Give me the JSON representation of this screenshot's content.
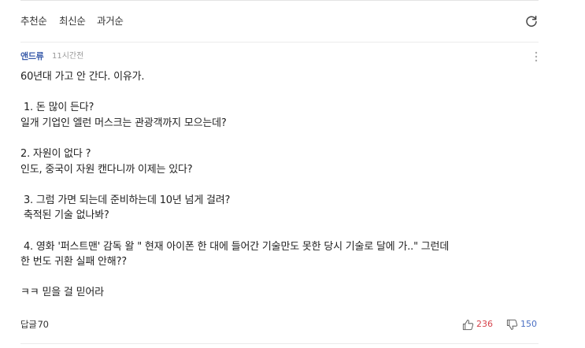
{
  "sort": {
    "tabs": [
      "추천순",
      "최신순",
      "과거순"
    ]
  },
  "comment": {
    "author": "앤드류",
    "time": "11시간전",
    "body": "60년대 가고 안 간다. 이유가.\n\n 1. 돈 많이 든다?\n일개 기업인 엘런 머스크는 관광객까지 모으는데?\n\n2. 자원이 없다 ?\n인도, 중국이 자원 캔다니까 이제는 있다?\n\n 3. 그럼 가면 되는데 준비하는데 10년 넘게 걸려?\n 축적된 기술 없나봐?\n\n 4. 영화 '퍼스트맨' 감독 왈 \" 현재 아이폰 한 대에 들어간 기술만도 못한 당시 기술로 달에 가..\" 그런데\n한 번도 귀환 실패 안해??\n\nㅋㅋ 믿을 걸 믿어라",
    "reply_label": "답글",
    "reply_count": "70",
    "like_count": "236",
    "dislike_count": "150"
  },
  "colors": {
    "author": "#3b5dab",
    "like": "#d6434b",
    "dislike": "#4a6fc3"
  },
  "icons": {
    "refresh": "refresh-icon",
    "more": "more-vertical-icon",
    "like": "thumbs-up-icon",
    "dislike": "thumbs-down-icon"
  }
}
